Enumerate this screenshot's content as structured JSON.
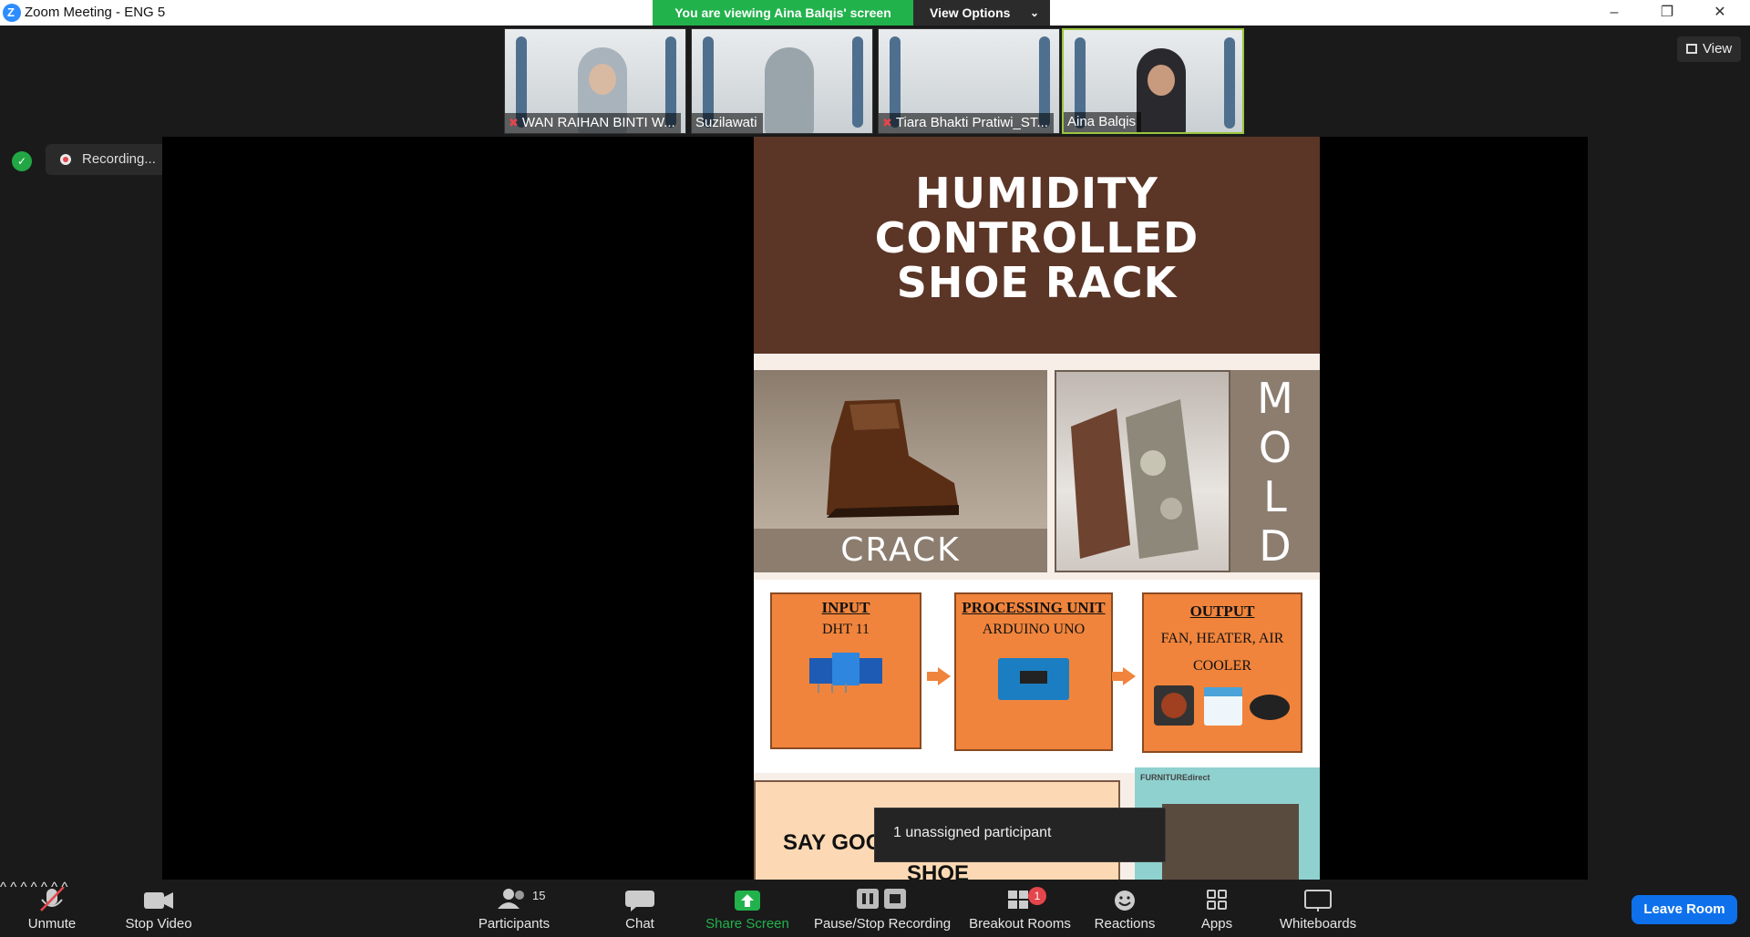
{
  "window": {
    "title": "Zoom Meeting - ENG 5",
    "viewing_banner": "You are viewing Aina Balqis' screen",
    "view_options_label": "View Options"
  },
  "view_button_label": "View",
  "participants_strip": [
    {
      "name": "WAN RAIHAN BINTI W...",
      "muted": true
    },
    {
      "name": "Suzilawati",
      "muted": false
    },
    {
      "name": "Tiara Bhakti Pratiwi_ST...",
      "muted": true
    },
    {
      "name": "Aina Balqis",
      "muted": false,
      "active_speaker": true
    }
  ],
  "recording": {
    "label": "Recording..."
  },
  "slide": {
    "title_lines": [
      "HUMIDITY",
      "CONTROLLED",
      "SHOE RACK"
    ],
    "crack_label": "CRACK",
    "mold_letters": [
      "M",
      "O",
      "L",
      "D"
    ],
    "flow": [
      {
        "heading": "INPUT",
        "text": "DHT 11"
      },
      {
        "heading": "PROCESSING UNIT",
        "text": "ARDUINO UNO"
      },
      {
        "heading": "OUTPUT",
        "text": "FAN, HEATER, AIR COOLER"
      }
    ],
    "goodbye_text": "SAY GOODBYE TO DAMA",
    "goodbye_text_2": "SHOE",
    "furniture_brand": "FURNITUREdirect"
  },
  "notification": "1 unassigned participant",
  "toolbar": {
    "unmute": "Unmute",
    "stop_video": "Stop Video",
    "participants": "Participants",
    "participants_count": "15",
    "chat": "Chat",
    "share_screen": "Share Screen",
    "pause_stop_recording": "Pause/Stop Recording",
    "breakout_rooms": "Breakout Rooms",
    "breakout_badge": "1",
    "reactions": "Reactions",
    "apps": "Apps",
    "whiteboards": "Whiteboards",
    "leave": "Leave Room"
  },
  "colors": {
    "accent_green": "#22b24c",
    "leave_blue": "#0e71eb",
    "slide_brown": "#5b3526",
    "flow_orange": "#f0843c"
  }
}
